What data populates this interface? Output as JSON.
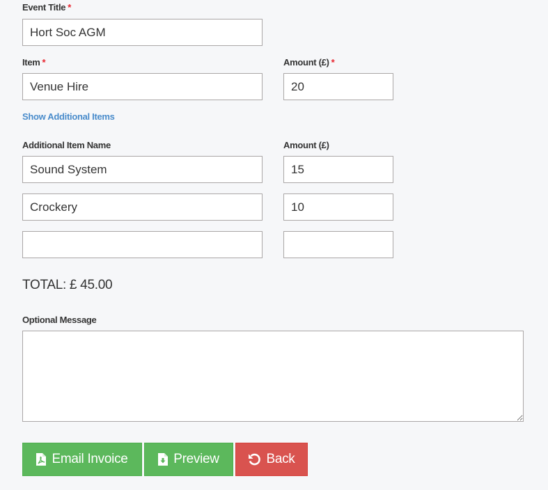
{
  "form": {
    "event_title": {
      "label": "Event Title",
      "required_mark": "*",
      "value": "Hort Soc AGM"
    },
    "item": {
      "label": "Item",
      "required_mark": "*",
      "value": "Venue Hire"
    },
    "amount": {
      "label": "Amount (£)",
      "required_mark": "*",
      "value": "20"
    },
    "show_additional_link": "Show Additional Items",
    "additional_items": {
      "name_header": "Additional Item Name",
      "amount_header": "Amount (£)",
      "rows": [
        {
          "name": "Sound System",
          "amount": "15"
        },
        {
          "name": "Crockery",
          "amount": "10"
        },
        {
          "name": "",
          "amount": ""
        }
      ]
    },
    "total": "TOTAL: £ 45.00",
    "optional_message": {
      "label": "Optional Message",
      "value": ""
    }
  },
  "buttons": {
    "email_invoice": {
      "label": "Email Invoice",
      "icon": "file-pdf-icon"
    },
    "preview": {
      "label": "Preview",
      "icon": "file-download-icon"
    },
    "back": {
      "label": "Back",
      "icon": "undo-icon"
    }
  },
  "colors": {
    "success": "#5cb85c",
    "danger": "#d9534f",
    "link": "#4a8ccb",
    "required": "#e8242e"
  }
}
